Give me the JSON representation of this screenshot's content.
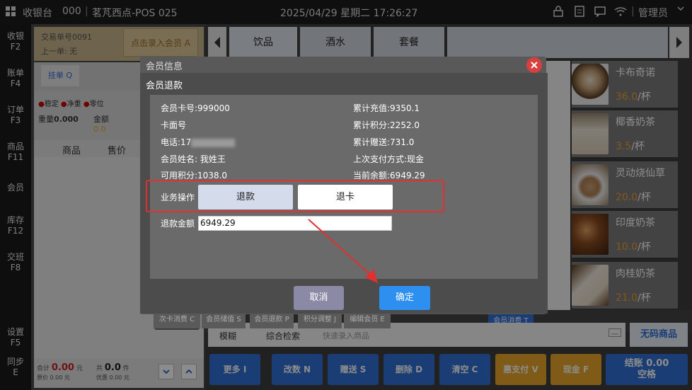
{
  "topbar": {
    "app": "收银台",
    "code": "000",
    "store": "茗芃西点-POS 025",
    "datetime": "2025/04/29 星期二 17:26:27",
    "user": "管理员"
  },
  "nav": [
    {
      "label": "收银",
      "key": "F2"
    },
    {
      "label": "账单",
      "key": "F4"
    },
    {
      "label": "订单",
      "key": "F3"
    },
    {
      "label": "商品",
      "key": "F11"
    },
    {
      "label": "会员",
      "key": ""
    },
    {
      "label": "库存",
      "key": "F12"
    },
    {
      "label": "交班",
      "key": "F8"
    },
    {
      "label": "设置",
      "key": "F5"
    },
    {
      "label": "同步",
      "key": "E"
    }
  ],
  "order": {
    "trade_no": "交易单号0091",
    "last": "上一单: 无",
    "member_btn": "点击录入会员 A",
    "hang_btn": "挂单 Q",
    "status": [
      "稳定",
      "净重",
      "零位"
    ],
    "weight_label": "重量",
    "weight_value": "0.000",
    "amount_label": "金额",
    "amount_value": "0.0",
    "col_item": "商品",
    "col_price": "售价",
    "total_label": "合计",
    "total_value": "0.00",
    "total_unit": "元",
    "orig_label": "原价",
    "orig_value": "0.00",
    "orig_unit": "元",
    "qty_label": "共",
    "qty_value": "0.0",
    "qty_unit": "件",
    "disc_label": "优惠",
    "disc_value": "0.00",
    "disc_unit": "元"
  },
  "tabs": [
    "饮品",
    "酒水",
    "套餐"
  ],
  "products": [
    {
      "name": "卡布奇诺",
      "price": "36.0",
      "unit": "/杯"
    },
    {
      "name": "椰香奶茶",
      "price": "3.5",
      "unit": "/杯"
    },
    {
      "name": "灵动烧仙草",
      "price": "20.0",
      "unit": "/杯"
    },
    {
      "name": "印度奶茶",
      "price": "10.0",
      "unit": "/杯"
    },
    {
      "name": "肉桂奶茶",
      "price": "21.0",
      "unit": "/杯"
    }
  ],
  "member_funcs": [
    "次卡消费 C",
    "会员储值 S",
    "会员退款 P",
    "积分调整 J",
    "编辑会员 E",
    "会员消费 T"
  ],
  "search": {
    "tab1": "模糊",
    "tab2": "综合检索",
    "placeholder": "快速录入商品",
    "nocode": "无码商品"
  },
  "bottom": [
    {
      "label": "更多 I",
      "color": "#2f6fd4"
    },
    {
      "label": "改数 N",
      "color": "#2f6fd4"
    },
    {
      "label": "赠送 S",
      "color": "#2f6fd4"
    },
    {
      "label": "删除 D",
      "color": "#2f6fd4"
    },
    {
      "label": "清空 C",
      "color": "#2f6fd4"
    },
    {
      "label": "惠支付 V",
      "color": "#e8a62a"
    },
    {
      "label": "现金 F",
      "color": "#e8a62a"
    },
    {
      "label": "结账 0.00\n空格",
      "color": "#2f6fd4"
    }
  ],
  "dialog": {
    "outer_title": "会员信息",
    "title": "会员退款",
    "card_no": "会员卡号:999000",
    "card_face": "卡面号",
    "phone": "电话:17",
    "name": "会员姓名: 我姓王",
    "points": "可用积分:1038.0",
    "recharge": "累计充值:9350.1",
    "total_points": "累计积分:2252.0",
    "gift": "累计赠送:731.0",
    "last_pay": "上次支付方式:现金",
    "balance": "当前余额:6949.29",
    "op_label": "业务操作",
    "refund": "退款",
    "cancel_card": "退卡",
    "amount_label": "退款金额",
    "amount_value": "6949.29",
    "cancel": "取消",
    "confirm": "确定"
  }
}
